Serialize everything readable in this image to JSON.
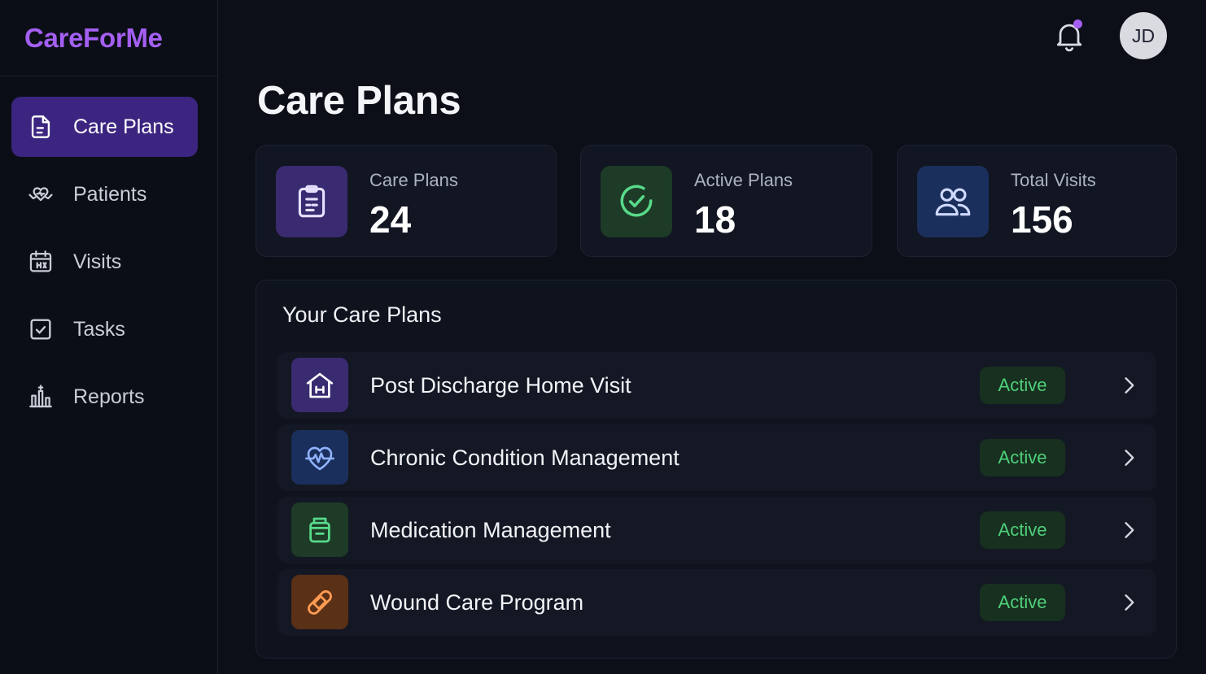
{
  "brand": {
    "name": "CareForMe",
    "color": "#a45ff2"
  },
  "sidebar": {
    "items": [
      {
        "label": "Care Plans",
        "icon": "document-icon",
        "active": true
      },
      {
        "label": "Patients",
        "icon": "heart-hands-icon",
        "active": false
      },
      {
        "label": "Visits",
        "icon": "calendar-icon",
        "active": false
      },
      {
        "label": "Tasks",
        "icon": "checkbox-icon",
        "active": false
      },
      {
        "label": "Reports",
        "icon": "bar-chart-icon",
        "active": false
      }
    ]
  },
  "header": {
    "notification_icon": "bell-icon",
    "has_unread": true,
    "avatar_initials": "JD"
  },
  "page": {
    "title": "Care Plans"
  },
  "stats": [
    {
      "label": "Care Plans",
      "value": "24",
      "icon": "clipboard-icon",
      "color": "#3a2a70"
    },
    {
      "label": "Active Plans",
      "value": "18",
      "icon": "check-circle-icon",
      "color": "#1d3b26"
    },
    {
      "label": "Total Visits",
      "value": "156",
      "icon": "users-icon",
      "color": "#1b2f5c"
    }
  ],
  "plans": {
    "title": "Your Care Plans",
    "items": [
      {
        "name": "Post Discharge Home Visit",
        "status": "Active",
        "icon": "home-icon",
        "color": "#3a2a70"
      },
      {
        "name": "Chronic Condition Management",
        "status": "Active",
        "icon": "heartbeat-icon",
        "color": "#1b2f5c"
      },
      {
        "name": "Medication Management",
        "status": "Active",
        "icon": "pill-bottle-icon",
        "color": "#1d3b26"
      },
      {
        "name": "Wound Care Program",
        "status": "Active",
        "icon": "bandage-icon",
        "color": "#5a3016"
      }
    ]
  },
  "colors": {
    "accent": "#a45ff2",
    "active_status": "#4fd07b",
    "background": "#0c0f18"
  }
}
